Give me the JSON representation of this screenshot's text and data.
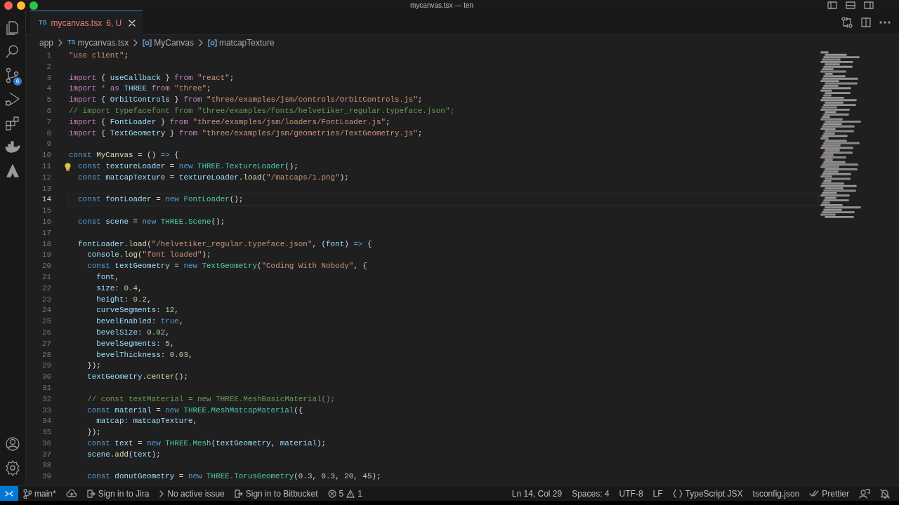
{
  "window": {
    "title": "mycanvas.tsx — ten"
  },
  "activity_bar": {
    "items": [
      {
        "kind": "files"
      },
      {
        "kind": "search"
      },
      {
        "kind": "scm",
        "badge": "6"
      },
      {
        "kind": "debug"
      },
      {
        "kind": "extensions"
      },
      {
        "kind": "docker"
      },
      {
        "kind": "atlassian"
      }
    ],
    "bottom": [
      {
        "kind": "account"
      },
      {
        "kind": "settings"
      }
    ]
  },
  "tabs": [
    {
      "lang": "TS",
      "label": "mycanvas.tsx",
      "status": "6, U",
      "selected": true
    }
  ],
  "breadcrumbs": [
    {
      "kind": "folder",
      "text": "app"
    },
    {
      "kind": "file",
      "lang": "TS",
      "text": "mycanvas.tsx"
    },
    {
      "kind": "symbol",
      "text": "MyCanvas"
    },
    {
      "kind": "symbol",
      "text": "matcapTexture"
    }
  ],
  "editor": {
    "lines": [
      {
        "number": "1",
        "tokens": [
          {
            "kind": "str",
            "text": "\"use client\""
          },
          {
            "kind": "pun",
            "text": ";"
          }
        ]
      },
      {
        "number": "2"
      },
      {
        "number": "3",
        "tokens": [
          {
            "kind": "ctl",
            "text": "import"
          },
          {
            "kind": "pun",
            "text": " { "
          },
          {
            "kind": "var",
            "text": "useCallback"
          },
          {
            "kind": "pun",
            "text": " } "
          },
          {
            "kind": "ctl",
            "text": "from"
          },
          {
            "kind": "str",
            "text": " \"react\""
          },
          {
            "kind": "pun",
            "text": ";"
          }
        ]
      },
      {
        "number": "4",
        "tokens": [
          {
            "kind": "ctl",
            "text": "import"
          },
          {
            "kind": "kw",
            "text": " * "
          },
          {
            "kind": "ctl",
            "text": "as"
          },
          {
            "kind": "var",
            "text": " THREE "
          },
          {
            "kind": "ctl",
            "text": "from"
          },
          {
            "kind": "str",
            "text": " \"three\""
          },
          {
            "kind": "pun",
            "text": ";"
          }
        ]
      },
      {
        "number": "5",
        "tokens": [
          {
            "kind": "ctl",
            "text": "import"
          },
          {
            "kind": "pun",
            "text": " { "
          },
          {
            "kind": "var",
            "text": "OrbitControls"
          },
          {
            "kind": "pun",
            "text": " } "
          },
          {
            "kind": "ctl",
            "text": "from"
          },
          {
            "kind": "str",
            "text": " \"three/examples/jsm/controls/OrbitControls.js\""
          },
          {
            "kind": "pun",
            "text": ";"
          }
        ]
      },
      {
        "number": "6",
        "tokens": [
          {
            "kind": "cmt",
            "text": "// import typefacefont from \"three/examples/fonts/helvetiker_regular.typeface.json\";"
          }
        ]
      },
      {
        "number": "7",
        "tokens": [
          {
            "kind": "ctl",
            "text": "import"
          },
          {
            "kind": "pun",
            "text": " { "
          },
          {
            "kind": "var",
            "text": "FontLoader"
          },
          {
            "kind": "pun",
            "text": " } "
          },
          {
            "kind": "ctl",
            "text": "from"
          },
          {
            "kind": "str",
            "text": " \"three/examples/jsm/loaders/FontLoader.js\""
          },
          {
            "kind": "pun",
            "text": ";"
          }
        ]
      },
      {
        "number": "8",
        "tokens": [
          {
            "kind": "ctl",
            "text": "import"
          },
          {
            "kind": "pun",
            "text": " { "
          },
          {
            "kind": "var",
            "text": "TextGeometry"
          },
          {
            "kind": "pun",
            "text": " } "
          },
          {
            "kind": "ctl",
            "text": "from"
          },
          {
            "kind": "str",
            "text": " \"three/examples/jsm/geometries/TextGeometry.js\""
          },
          {
            "kind": "pun",
            "text": ";"
          }
        ]
      },
      {
        "number": "9"
      },
      {
        "number": "10",
        "tokens": [
          {
            "kind": "kw",
            "text": "const"
          },
          {
            "kind": "fn",
            "text": " MyCanvas"
          },
          {
            "kind": "pun",
            "text": " = () "
          },
          {
            "kind": "kw",
            "text": "=>"
          },
          {
            "kind": "pun",
            "text": " {"
          }
        ]
      },
      {
        "number": "11",
        "lightbulb": true,
        "tokens": [
          {
            "kind": "kw",
            "text": "  const"
          },
          {
            "kind": "var",
            "text": " textureLoader"
          },
          {
            "kind": "pun",
            "text": " = "
          },
          {
            "kind": "kw",
            "text": "new"
          },
          {
            "kind": "type",
            "text": " THREE.TextureLoader"
          },
          {
            "kind": "pun",
            "text": "();"
          }
        ]
      },
      {
        "number": "12",
        "tokens": [
          {
            "kind": "kw",
            "text": "  const"
          },
          {
            "kind": "var",
            "text": " matcapTexture"
          },
          {
            "kind": "pun",
            "text": " = "
          },
          {
            "kind": "var",
            "text": "textureLoader"
          },
          {
            "kind": "fn",
            "text": ".load"
          },
          {
            "kind": "pun",
            "text": "("
          },
          {
            "kind": "str",
            "text": "\"/matcaps/1.png\""
          },
          {
            "kind": "pun",
            "text": ");"
          }
        ]
      },
      {
        "number": "13"
      },
      {
        "number": "14",
        "selected": true,
        "tokens": [
          {
            "kind": "kw",
            "text": "  const"
          },
          {
            "kind": "var",
            "text": " fontLoader"
          },
          {
            "kind": "pun",
            "text": " = "
          },
          {
            "kind": "kw",
            "text": "new"
          },
          {
            "kind": "type",
            "text": " FontLoader"
          },
          {
            "kind": "pun",
            "text": "();"
          }
        ]
      },
      {
        "number": "15"
      },
      {
        "number": "16",
        "tokens": [
          {
            "kind": "kw",
            "text": "  const"
          },
          {
            "kind": "var",
            "text": " scene"
          },
          {
            "kind": "pun",
            "text": " = "
          },
          {
            "kind": "kw",
            "text": "new"
          },
          {
            "kind": "type",
            "text": " THREE.Scene"
          },
          {
            "kind": "pun",
            "text": "();"
          }
        ]
      },
      {
        "number": "17"
      },
      {
        "number": "18",
        "tokens": [
          {
            "kind": "var",
            "text": "  fontLoader"
          },
          {
            "kind": "fn",
            "text": ".load"
          },
          {
            "kind": "pun",
            "text": "("
          },
          {
            "kind": "str",
            "text": "\"/helvetiker_regular.typeface.json\""
          },
          {
            "kind": "pun",
            "text": ", ("
          },
          {
            "kind": "var",
            "text": "font"
          },
          {
            "kind": "pun",
            "text": ") "
          },
          {
            "kind": "kw",
            "text": "=>"
          },
          {
            "kind": "pun",
            "text": " {"
          }
        ]
      },
      {
        "number": "19",
        "tokens": [
          {
            "kind": "var",
            "text": "    console"
          },
          {
            "kind": "fn",
            "text": ".log"
          },
          {
            "kind": "pun",
            "text": "("
          },
          {
            "kind": "str",
            "text": "\"font loaded\""
          },
          {
            "kind": "pun",
            "text": ");"
          }
        ]
      },
      {
        "number": "20",
        "tokens": [
          {
            "kind": "kw",
            "text": "    const"
          },
          {
            "kind": "var",
            "text": " textGeometry"
          },
          {
            "kind": "pun",
            "text": " = "
          },
          {
            "kind": "kw",
            "text": "new"
          },
          {
            "kind": "type",
            "text": " TextGeometry"
          },
          {
            "kind": "pun",
            "text": "("
          },
          {
            "kind": "str",
            "text": "\"Coding With Nobody\""
          },
          {
            "kind": "pun",
            "text": ", {"
          }
        ]
      },
      {
        "number": "21",
        "tokens": [
          {
            "kind": "var",
            "text": "      font"
          },
          {
            "kind": "pun",
            "text": ","
          }
        ]
      },
      {
        "number": "22",
        "tokens": [
          {
            "kind": "var",
            "text": "      size"
          },
          {
            "kind": "pun",
            "text": ": "
          },
          {
            "kind": "num",
            "text": "0.4"
          },
          {
            "kind": "pun",
            "text": ","
          }
        ]
      },
      {
        "number": "23",
        "tokens": [
          {
            "kind": "var",
            "text": "      height"
          },
          {
            "kind": "pun",
            "text": ": "
          },
          {
            "kind": "num",
            "text": "0.2"
          },
          {
            "kind": "pun",
            "text": ","
          }
        ]
      },
      {
        "number": "24",
        "tokens": [
          {
            "kind": "var",
            "text": "      curveSegments"
          },
          {
            "kind": "pun",
            "text": ": "
          },
          {
            "kind": "num",
            "text": "12"
          },
          {
            "kind": "pun",
            "text": ","
          }
        ]
      },
      {
        "number": "25",
        "tokens": [
          {
            "kind": "var",
            "text": "      bevelEnabled"
          },
          {
            "kind": "pun",
            "text": ": "
          },
          {
            "kind": "kw",
            "text": "true"
          },
          {
            "kind": "pun",
            "text": ","
          }
        ]
      },
      {
        "number": "26",
        "tokens": [
          {
            "kind": "var",
            "text": "      bevelSize"
          },
          {
            "kind": "pun",
            "text": ": "
          },
          {
            "kind": "num",
            "text": "0.02"
          },
          {
            "kind": "pun",
            "text": ","
          }
        ]
      },
      {
        "number": "27",
        "tokens": [
          {
            "kind": "var",
            "text": "      bevelSegments"
          },
          {
            "kind": "pun",
            "text": ": "
          },
          {
            "kind": "num",
            "text": "5"
          },
          {
            "kind": "pun",
            "text": ","
          }
        ]
      },
      {
        "number": "28",
        "tokens": [
          {
            "kind": "var",
            "text": "      bevelThickness"
          },
          {
            "kind": "pun",
            "text": ": "
          },
          {
            "kind": "num",
            "text": "0.03"
          },
          {
            "kind": "pun",
            "text": ","
          }
        ]
      },
      {
        "number": "29",
        "tokens": [
          {
            "kind": "pun",
            "text": "    });"
          }
        ]
      },
      {
        "number": "30",
        "tokens": [
          {
            "kind": "var",
            "text": "    textGeometry"
          },
          {
            "kind": "fn",
            "text": ".center"
          },
          {
            "kind": "pun",
            "text": "();"
          }
        ]
      },
      {
        "number": "31"
      },
      {
        "number": "32",
        "tokens": [
          {
            "kind": "cmt",
            "text": "    // const textMaterial = new THREE.MeshBasicMaterial();"
          }
        ]
      },
      {
        "number": "33",
        "tokens": [
          {
            "kind": "kw",
            "text": "    const"
          },
          {
            "kind": "var",
            "text": " material"
          },
          {
            "kind": "pun",
            "text": " = "
          },
          {
            "kind": "kw",
            "text": "new"
          },
          {
            "kind": "type",
            "text": " THREE.MeshMatcapMaterial"
          },
          {
            "kind": "pun",
            "text": "({"
          }
        ]
      },
      {
        "number": "34",
        "tokens": [
          {
            "kind": "var",
            "text": "      matcap"
          },
          {
            "kind": "pun",
            "text": ": "
          },
          {
            "kind": "var",
            "text": "matcapTexture"
          },
          {
            "kind": "pun",
            "text": ","
          }
        ]
      },
      {
        "number": "35",
        "tokens": [
          {
            "kind": "pun",
            "text": "    });"
          }
        ]
      },
      {
        "number": "36",
        "tokens": [
          {
            "kind": "kw",
            "text": "    const"
          },
          {
            "kind": "var",
            "text": " text"
          },
          {
            "kind": "pun",
            "text": " = "
          },
          {
            "kind": "kw",
            "text": "new"
          },
          {
            "kind": "type",
            "text": " THREE.Mesh"
          },
          {
            "kind": "pun",
            "text": "("
          },
          {
            "kind": "var",
            "text": "textGeometry"
          },
          {
            "kind": "pun",
            "text": ", "
          },
          {
            "kind": "var",
            "text": "material"
          },
          {
            "kind": "pun",
            "text": ");"
          }
        ]
      },
      {
        "number": "37",
        "tokens": [
          {
            "kind": "var",
            "text": "    scene"
          },
          {
            "kind": "fn",
            "text": ".add"
          },
          {
            "kind": "pun",
            "text": "("
          },
          {
            "kind": "var",
            "text": "text"
          },
          {
            "kind": "pun",
            "text": ");"
          }
        ]
      },
      {
        "number": "38"
      },
      {
        "number": "39",
        "tokens": [
          {
            "kind": "kw",
            "text": "    const"
          },
          {
            "kind": "var",
            "text": " donutGeometry"
          },
          {
            "kind": "pun",
            "text": " = "
          },
          {
            "kind": "kw",
            "text": "new"
          },
          {
            "kind": "type",
            "text": " THREE.TorusGeometry"
          },
          {
            "kind": "pun",
            "text": "("
          },
          {
            "kind": "num",
            "text": "0.3"
          },
          {
            "kind": "pun",
            "text": ", "
          },
          {
            "kind": "num",
            "text": "0.3"
          },
          {
            "kind": "pun",
            "text": ", "
          },
          {
            "kind": "num",
            "text": "20"
          },
          {
            "kind": "pun",
            "text": ", "
          },
          {
            "kind": "num",
            "text": "45"
          },
          {
            "kind": "pun",
            "text": ");"
          }
        ]
      }
    ]
  },
  "status_bar": {
    "left": [
      {
        "kind": "remote"
      },
      {
        "kind": "branch",
        "text": "main*"
      },
      {
        "kind": "sync"
      },
      {
        "kind": "signin",
        "text": "Sign in to Jira"
      },
      {
        "kind": "issue",
        "text": "No active issue"
      },
      {
        "kind": "signin",
        "text": "Sign in to Bitbucket"
      },
      {
        "kind": "problems",
        "errors": "5",
        "warnings": "1"
      }
    ],
    "right": [
      {
        "kind": "plain",
        "text": "Ln 14, Col 29"
      },
      {
        "kind": "plain",
        "text": "Spaces: 4"
      },
      {
        "kind": "plain",
        "text": "UTF-8"
      },
      {
        "kind": "plain",
        "text": "LF"
      },
      {
        "kind": "language",
        "text": "TypeScript JSX"
      },
      {
        "kind": "plain",
        "text": "tsconfig.json"
      },
      {
        "kind": "formatter",
        "text": "Prettier"
      },
      {
        "kind": "feedback"
      },
      {
        "kind": "bell"
      }
    ]
  }
}
